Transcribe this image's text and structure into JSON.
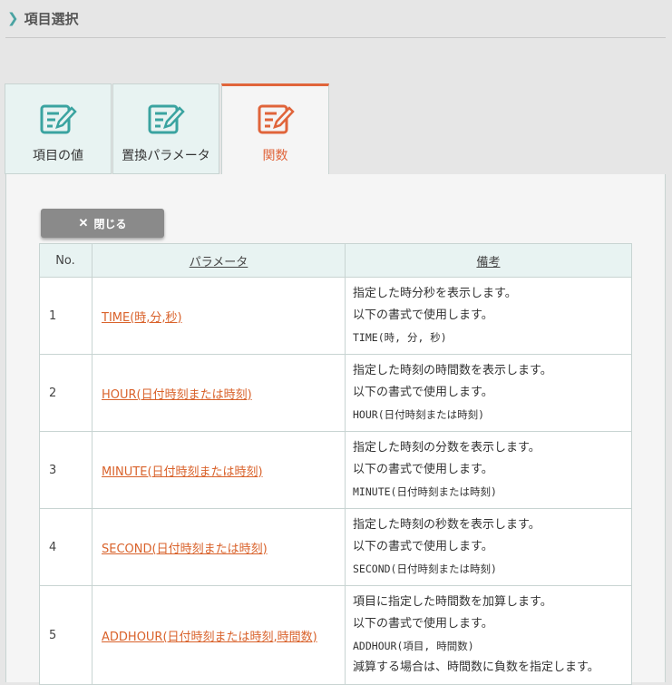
{
  "header": {
    "title": "項目選択"
  },
  "tabs": [
    {
      "label": "項目の値"
    },
    {
      "label": "置換パラメータ"
    },
    {
      "label": "関数"
    }
  ],
  "colors": {
    "teal": "#3aa3a0",
    "orange": "#e0643a"
  },
  "close_button": {
    "label": "閉じる"
  },
  "table": {
    "headers": {
      "no": "No.",
      "param": "パラメータ",
      "note": "備考"
    },
    "rows": [
      {
        "no": "1",
        "param": "TIME(時,分,秒)",
        "notes": [
          "指定した時分秒を表示します。",
          "以下の書式で使用します。",
          "TIME(時, 分, 秒)"
        ]
      },
      {
        "no": "2",
        "param": "HOUR(日付時刻または時刻)",
        "notes": [
          "指定した時刻の時間数を表示します。",
          "以下の書式で使用します。",
          "HOUR(日付時刻または時刻)"
        ]
      },
      {
        "no": "3",
        "param": "MINUTE(日付時刻または時刻)",
        "notes": [
          "指定した時刻の分数を表示します。",
          "以下の書式で使用します。",
          "MINUTE(日付時刻または時刻)"
        ]
      },
      {
        "no": "4",
        "param": "SECOND(日付時刻または時刻)",
        "notes": [
          "指定した時刻の秒数を表示します。",
          "以下の書式で使用します。",
          "SECOND(日付時刻または時刻)"
        ]
      },
      {
        "no": "5",
        "param": "ADDHOUR(日付時刻または時刻,時間数)",
        "notes": [
          "項目に指定した時間数を加算します。",
          "以下の書式で使用します。",
          "ADDHOUR(項目, 時間数)",
          "減算する場合は、時間数に負数を指定します。"
        ]
      }
    ]
  }
}
